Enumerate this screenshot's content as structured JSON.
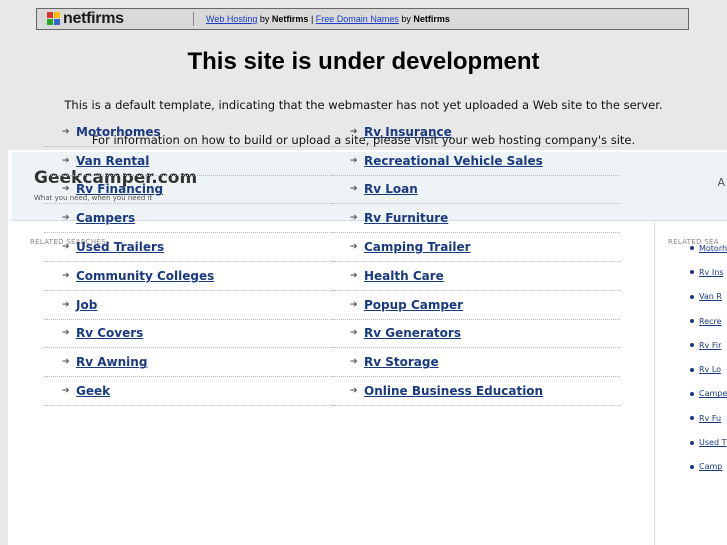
{
  "topbar": {
    "logo": "netfirms",
    "link1": "Web Hosting",
    "by1": "by",
    "brand1": "Netfirms",
    "sep": "|",
    "link2": "Free Domain Names",
    "by2": "by",
    "brand2": "Netfirms"
  },
  "heading": "This site is under development",
  "message1": "This is a default template, indicating that the webmaster has not yet uploaded a Web site to the server.",
  "message2": "For information on how to build or upload a site, please visit your web hosting company's site.",
  "panel": {
    "site_title": "Geekcamper.com",
    "tagline": "What you need, when you need it",
    "head_right": "A",
    "related_label": "RELATED SEARCHES",
    "related_label_right": "RELATED SEA",
    "searches": [
      {
        "left": "Motorhomes",
        "left_u": false,
        "right": "Rv Insurance",
        "right_u": true
      },
      {
        "left": "Van Rental",
        "left_u": true,
        "right": "Recreational Vehicle Sales",
        "right_u": true
      },
      {
        "left": "Rv Financing",
        "left_u": true,
        "right": "Rv Loan",
        "right_u": true
      },
      {
        "left": "Campers",
        "left_u": true,
        "right": "Rv Furniture",
        "right_u": true
      },
      {
        "left": "Used Trailers",
        "left_u": true,
        "right": "Camping Trailer",
        "right_u": true
      },
      {
        "left": "Community Colleges",
        "left_u": true,
        "right": "Health Care",
        "right_u": true
      },
      {
        "left": "Job",
        "left_u": true,
        "right": "Popup Camper",
        "right_u": true
      },
      {
        "left": "Rv Covers",
        "left_u": true,
        "right": "Rv Generators",
        "right_u": true
      },
      {
        "left": "Rv Awning",
        "left_u": true,
        "right": "Rv Storage",
        "right_u": true
      },
      {
        "left": "Geek",
        "left_u": true,
        "right": "Online Business Education",
        "right_u": true
      }
    ],
    "side_searches": [
      "Motorh",
      "Rv Ins",
      "Van R",
      "Recre",
      "Rv Fir",
      "Rv Lo",
      "Campe",
      "Rv Fu",
      "Used T",
      "Camp"
    ]
  }
}
